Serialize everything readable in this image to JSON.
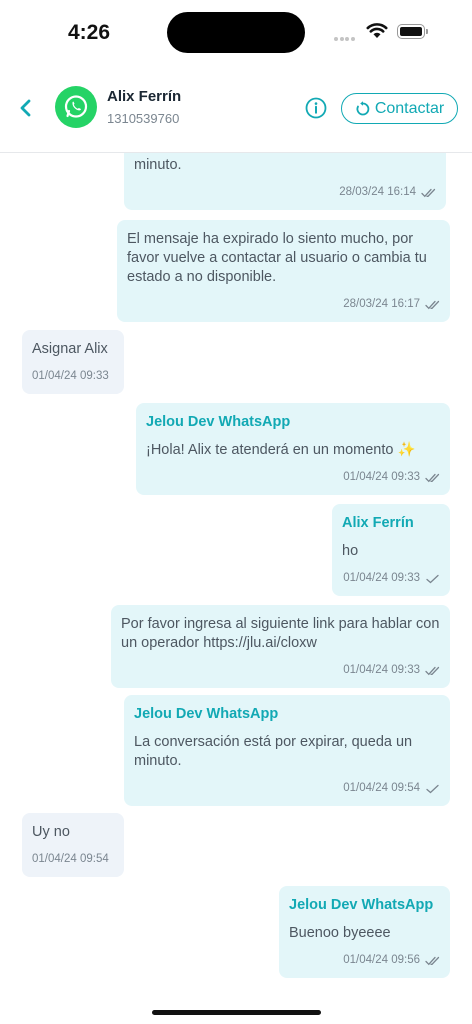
{
  "status_bar": {
    "time": "4:26"
  },
  "header": {
    "contact_name": "Alix Ferrín",
    "contact_phone": "1310539760",
    "contact_button": "Contactar"
  },
  "colors": {
    "accent": "#12a9b4",
    "whatsapp": "#25d366",
    "bubble_out": "#e3f6f9",
    "bubble_in": "#eef3f9"
  },
  "messages": [
    {
      "direction": "out",
      "sender": "",
      "text": "minuto.",
      "time": "28/03/24 16:14",
      "status": "double-check"
    },
    {
      "direction": "out",
      "sender": "",
      "text": "El mensaje ha expirado lo siento mucho, por favor vuelve a contactar al usuario o cambia tu estado a no disponible.",
      "time": "28/03/24 16:17",
      "status": "double-check"
    },
    {
      "direction": "in",
      "sender": "",
      "text": "Asignar Alix",
      "time": "01/04/24 09:33",
      "status": ""
    },
    {
      "direction": "out",
      "sender": "Jelou Dev WhatsApp",
      "text": "¡Hola! Alix te atenderá en un momento ✨",
      "time": "01/04/24 09:33",
      "status": "double-check"
    },
    {
      "direction": "out",
      "sender": "Alix Ferrín",
      "text": "ho",
      "time": "01/04/24 09:33",
      "status": "single-check"
    },
    {
      "direction": "out",
      "sender": "",
      "text": "Por favor ingresa al siguiente link para hablar con un operador https://jlu.ai/cloxw",
      "time": "01/04/24 09:33",
      "status": "double-check"
    },
    {
      "direction": "out",
      "sender": "Jelou Dev WhatsApp",
      "text": "La conversación está por expirar, queda un minuto.",
      "time": "01/04/24 09:54",
      "status": "single-check"
    },
    {
      "direction": "in",
      "sender": "",
      "text": "Uy no",
      "time": "01/04/24 09:54",
      "status": ""
    },
    {
      "direction": "out",
      "sender": "Jelou Dev WhatsApp",
      "text": "Buenoo byeeee",
      "time": "01/04/24 09:56",
      "status": "double-check"
    }
  ]
}
